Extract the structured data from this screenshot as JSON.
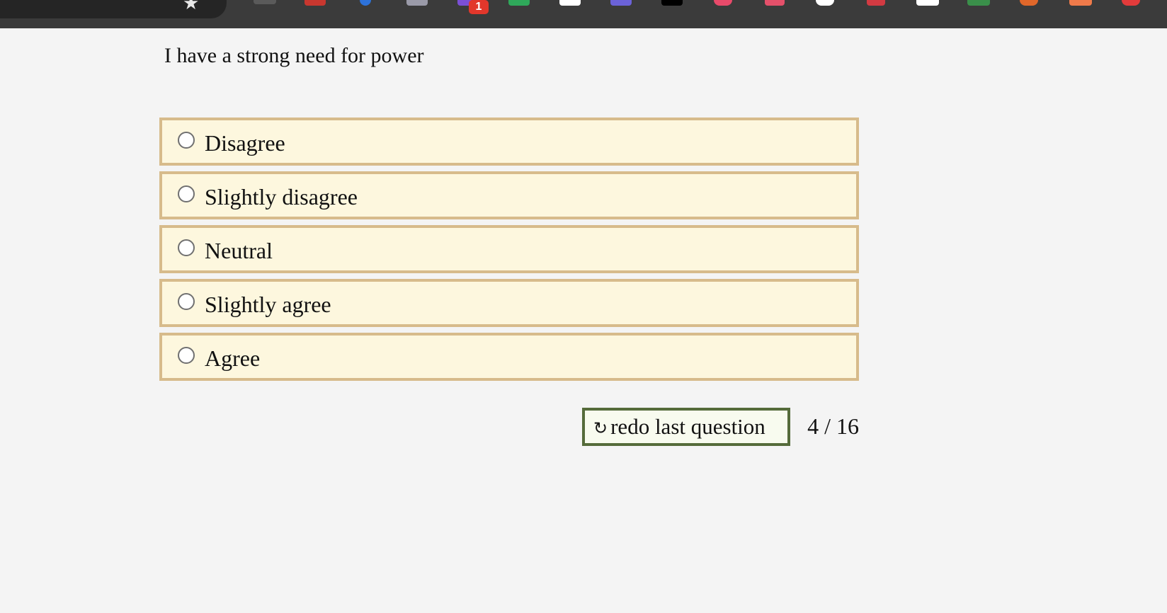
{
  "browser": {
    "extensions": [
      {
        "name": "ext-icon-1",
        "color": "#666666"
      },
      {
        "name": "ext-icon-2",
        "color": "#c8372f"
      },
      {
        "name": "ext-icon-3",
        "color": "#2d72d9"
      },
      {
        "name": "ext-icon-4",
        "color": "#9a9aa8"
      },
      {
        "name": "ext-icon-5",
        "color": "#7b4fd6"
      },
      {
        "name": "ext-icon-6",
        "color": "#2fa85a"
      },
      {
        "name": "ext-icon-7",
        "color": "#ffffff"
      },
      {
        "name": "ext-icon-8",
        "color": "#6b62d8"
      },
      {
        "name": "ext-icon-9",
        "color": "#000000"
      },
      {
        "name": "ext-icon-10",
        "color": "#e84a6a"
      },
      {
        "name": "ext-icon-11",
        "color": "#e4506a"
      },
      {
        "name": "ext-icon-12",
        "color": "#ffffff"
      },
      {
        "name": "ext-icon-13",
        "color": "#d23a42"
      },
      {
        "name": "ext-icon-14",
        "color": "#ffffff"
      },
      {
        "name": "ext-icon-15",
        "color": "#3a8f4a"
      },
      {
        "name": "ext-icon-16",
        "color": "#e0672a"
      },
      {
        "name": "ext-icon-17",
        "color": "#ef7a4a"
      },
      {
        "name": "ext-icon-18",
        "color": "#e23b3b"
      }
    ],
    "badge_count": "1"
  },
  "quiz": {
    "question": "I have a strong need for power",
    "options": [
      {
        "label": "Disagree"
      },
      {
        "label": "Slightly disagree"
      },
      {
        "label": "Neutral"
      },
      {
        "label": "Slightly agree"
      },
      {
        "label": "Agree"
      }
    ],
    "redo_icon": "↻",
    "redo_label": "redo last question",
    "progress": "4 / 16"
  }
}
